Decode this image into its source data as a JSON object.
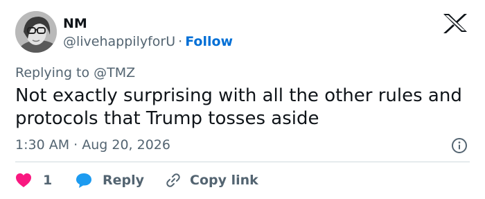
{
  "author": {
    "name": "NM",
    "handle": "@livehappilyforU",
    "separator": "·",
    "follow_label": "Follow",
    "avatar_icon": "profile-photo"
  },
  "reply_context": {
    "prefix": "Replying to",
    "mention": "@TMZ"
  },
  "tweet": {
    "text": "Not exactly surprising with all the other rules and protocols that Trump tosses aside",
    "timestamp": "1:30 AM · Aug 20, 2026"
  },
  "actions": {
    "like_count": "1",
    "reply_label": "Reply",
    "copy_link_label": "Copy link"
  },
  "icons": {
    "brand": "x-logo-icon",
    "info": "info-icon",
    "like": "heart-icon",
    "reply": "speech-bubble-icon",
    "copy": "link-icon"
  },
  "colors": {
    "text_primary": "#0f1419",
    "text_secondary": "#536471",
    "link_blue": "#006fd6",
    "heart": "#f91880",
    "reply_bubble": "#1d9bf0",
    "divider": "#cfd9de"
  }
}
